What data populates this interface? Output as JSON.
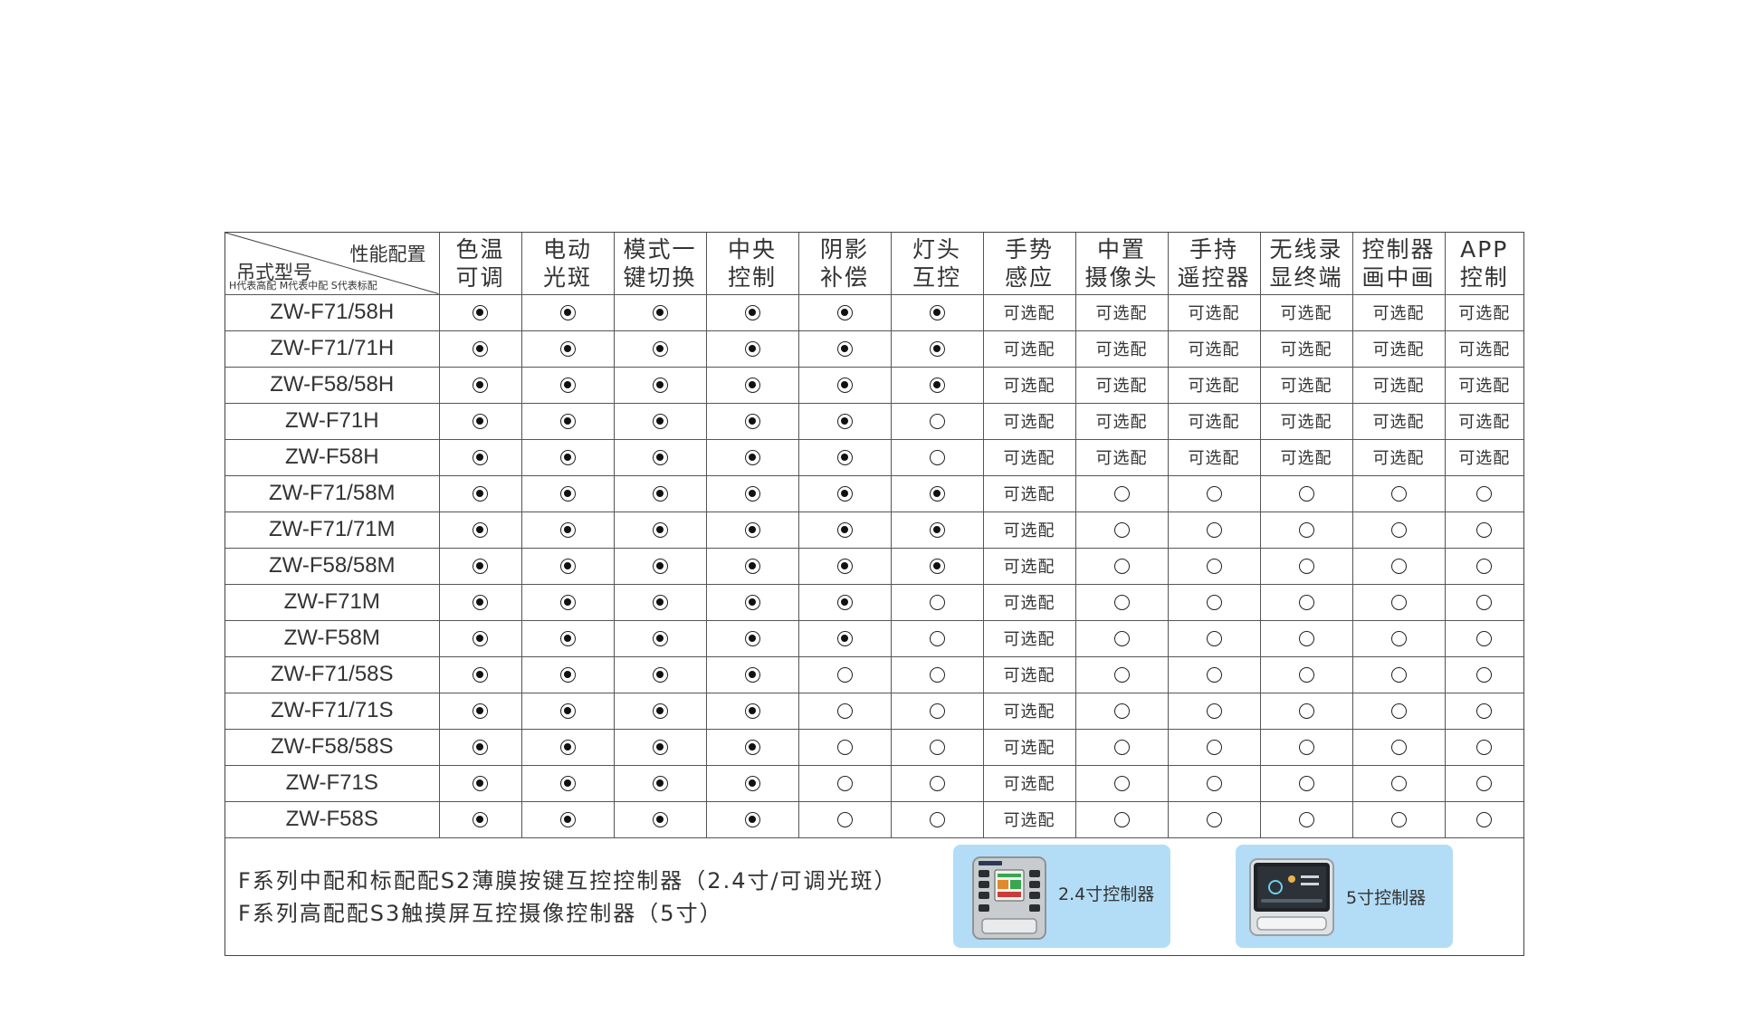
{
  "header": {
    "corner_top_right": "性能配置",
    "corner_bottom_left": "吊式型号",
    "corner_note": "H代表高配 M代表中配 S代表标配",
    "features": [
      {
        "line1": "色温",
        "line2": "可调"
      },
      {
        "line1": "电动",
        "line2": "光斑"
      },
      {
        "line1": "模式一",
        "line2": "键切换"
      },
      {
        "line1": "中央",
        "line2": "控制"
      },
      {
        "line1": "阴影",
        "line2": "补偿"
      },
      {
        "line1": "灯头",
        "line2": "互控"
      },
      {
        "line1": "手势",
        "line2": "感应"
      },
      {
        "line1": "中置",
        "line2": "摄像头"
      },
      {
        "line1": "手持",
        "line2": "遥控器"
      },
      {
        "line1": "无线录",
        "line2": "显终端"
      },
      {
        "line1": "控制器",
        "line2": "画中画"
      },
      {
        "line1": "APP",
        "line2": "控制"
      }
    ]
  },
  "legend": {
    "on": "standard (filled circle)",
    "off": "not included (empty circle)",
    "optional_text": "可选配"
  },
  "rows": [
    {
      "model": "ZW-F71/58H",
      "cells": [
        "on",
        "on",
        "on",
        "on",
        "on",
        "on",
        "opt",
        "opt",
        "opt",
        "opt",
        "opt",
        "opt"
      ]
    },
    {
      "model": "ZW-F71/71H",
      "cells": [
        "on",
        "on",
        "on",
        "on",
        "on",
        "on",
        "opt",
        "opt",
        "opt",
        "opt",
        "opt",
        "opt"
      ]
    },
    {
      "model": "ZW-F58/58H",
      "cells": [
        "on",
        "on",
        "on",
        "on",
        "on",
        "on",
        "opt",
        "opt",
        "opt",
        "opt",
        "opt",
        "opt"
      ]
    },
    {
      "model": "ZW-F71H",
      "cells": [
        "on",
        "on",
        "on",
        "on",
        "on",
        "off",
        "opt",
        "opt",
        "opt",
        "opt",
        "opt",
        "opt"
      ]
    },
    {
      "model": "ZW-F58H",
      "cells": [
        "on",
        "on",
        "on",
        "on",
        "on",
        "off",
        "opt",
        "opt",
        "opt",
        "opt",
        "opt",
        "opt"
      ]
    },
    {
      "model": "ZW-F71/58M",
      "cells": [
        "on",
        "on",
        "on",
        "on",
        "on",
        "on",
        "opt",
        "off",
        "off",
        "off",
        "off",
        "off"
      ]
    },
    {
      "model": "ZW-F71/71M",
      "cells": [
        "on",
        "on",
        "on",
        "on",
        "on",
        "on",
        "opt",
        "off",
        "off",
        "off",
        "off",
        "off"
      ]
    },
    {
      "model": "ZW-F58/58M",
      "cells": [
        "on",
        "on",
        "on",
        "on",
        "on",
        "on",
        "opt",
        "off",
        "off",
        "off",
        "off",
        "off"
      ]
    },
    {
      "model": "ZW-F71M",
      "cells": [
        "on",
        "on",
        "on",
        "on",
        "on",
        "off",
        "opt",
        "off",
        "off",
        "off",
        "off",
        "off"
      ]
    },
    {
      "model": "ZW-F58M",
      "cells": [
        "on",
        "on",
        "on",
        "on",
        "on",
        "off",
        "opt",
        "off",
        "off",
        "off",
        "off",
        "off"
      ]
    },
    {
      "model": "ZW-F71/58S",
      "cells": [
        "on",
        "on",
        "on",
        "on",
        "off",
        "off",
        "opt",
        "off",
        "off",
        "off",
        "off",
        "off"
      ]
    },
    {
      "model": "ZW-F71/71S",
      "cells": [
        "on",
        "on",
        "on",
        "on",
        "off",
        "off",
        "opt",
        "off",
        "off",
        "off",
        "off",
        "off"
      ]
    },
    {
      "model": "ZW-F58/58S",
      "cells": [
        "on",
        "on",
        "on",
        "on",
        "off",
        "off",
        "opt",
        "off",
        "off",
        "off",
        "off",
        "off"
      ]
    },
    {
      "model": "ZW-F71S",
      "cells": [
        "on",
        "on",
        "on",
        "on",
        "off",
        "off",
        "opt",
        "off",
        "off",
        "off",
        "off",
        "off"
      ]
    },
    {
      "model": "ZW-F58S",
      "cells": [
        "on",
        "on",
        "on",
        "on",
        "off",
        "off",
        "opt",
        "off",
        "off",
        "off",
        "off",
        "off"
      ]
    }
  ],
  "footer": {
    "note1": "F系列中配和标配配S2薄膜按键互控控制器（2.4寸/可调光斑）",
    "note2": "F系列高配配S3触摸屏互控摄像控制器（5寸）",
    "card1_label": "2.4寸控制器",
    "card2_label": "5寸控制器"
  },
  "colors": {
    "card_bg": "#b3ddf6",
    "border": "#555555",
    "text": "#333333"
  }
}
